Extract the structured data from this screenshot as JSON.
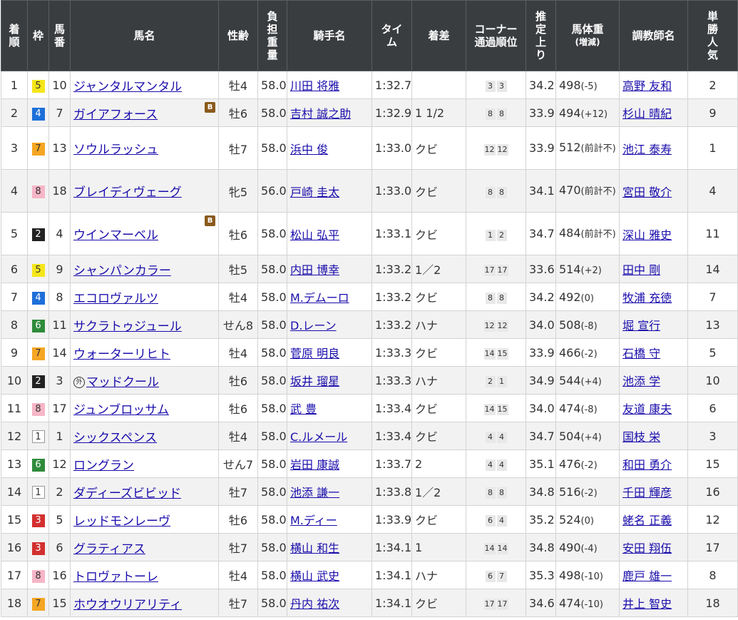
{
  "headers": {
    "rank": "着順",
    "frame": "枠",
    "num": "馬番",
    "horse": "馬名",
    "sexage": "性齢",
    "load": "負担重量",
    "jockey": "騎手名",
    "time": "タイム",
    "margin": "着差",
    "corner": "コーナー通過順位",
    "last3f": "推定上り",
    "weight": "馬体重",
    "weight_sub": "(増減)",
    "trainer": "調教師名",
    "pop": "単勝人気"
  },
  "rows": [
    {
      "rank": "1",
      "frame": "5",
      "num": "10",
      "horse": "ジャンタルマンタル",
      "blinker": "",
      "foreign": "",
      "sexage": "牡4",
      "load": "58.0",
      "jockey": "川田 将雅",
      "time": "1:32.7",
      "margin": "",
      "c1": "3",
      "c2": "3",
      "last3f": "34.2",
      "weight": "498",
      "diff": "(-5)",
      "trainer": "高野 友和",
      "pop": "2"
    },
    {
      "rank": "2",
      "frame": "4",
      "num": "7",
      "horse": "ガイアフォース",
      "blinker": "B",
      "foreign": "",
      "sexage": "牡6",
      "load": "58.0",
      "jockey": "吉村 誠之助",
      "time": "1:32.9",
      "margin": "1 1/2",
      "c1": "8",
      "c2": "8",
      "last3f": "33.9",
      "weight": "494",
      "diff": "(+12)",
      "trainer": "杉山 晴紀",
      "pop": "9"
    },
    {
      "rank": "3",
      "frame": "7",
      "num": "13",
      "horse": "ソウルラッシュ",
      "blinker": "",
      "foreign": "",
      "sexage": "牡7",
      "load": "58.0",
      "jockey": "浜中 俊",
      "time": "1:33.0",
      "margin": "クビ",
      "c1": "12",
      "c2": "12",
      "last3f": "33.9",
      "weight": "512",
      "diff": "(前計不)",
      "trainer": "池江 泰寿",
      "pop": "1"
    },
    {
      "rank": "4",
      "frame": "8",
      "num": "18",
      "horse": "ブレイディヴェーグ",
      "blinker": "",
      "foreign": "",
      "sexage": "牝5",
      "load": "56.0",
      "jockey": "戸崎 圭太",
      "time": "1:33.0",
      "margin": "クビ",
      "c1": "8",
      "c2": "8",
      "last3f": "34.1",
      "weight": "470",
      "diff": "(前計不)",
      "trainer": "宮田 敬介",
      "pop": "4"
    },
    {
      "rank": "5",
      "frame": "2",
      "num": "4",
      "horse": "ウインマーベル",
      "blinker": "B",
      "foreign": "",
      "sexage": "牡6",
      "load": "58.0",
      "jockey": "松山 弘平",
      "time": "1:33.1",
      "margin": "クビ",
      "c1": "1",
      "c2": "2",
      "last3f": "34.7",
      "weight": "484",
      "diff": "(前計不)",
      "trainer": "深山 雅史",
      "pop": "11"
    },
    {
      "rank": "6",
      "frame": "5",
      "num": "9",
      "horse": "シャンパンカラー",
      "blinker": "",
      "foreign": "",
      "sexage": "牡5",
      "load": "58.0",
      "jockey": "内田 博幸",
      "time": "1:33.2",
      "margin": "1／2",
      "c1": "17",
      "c2": "17",
      "last3f": "33.6",
      "weight": "514",
      "diff": "(+2)",
      "trainer": "田中 剛",
      "pop": "14"
    },
    {
      "rank": "7",
      "frame": "4",
      "num": "8",
      "horse": "エコロヴァルツ",
      "blinker": "",
      "foreign": "",
      "sexage": "牡4",
      "load": "58.0",
      "jockey": "M.デムーロ",
      "time": "1:33.2",
      "margin": "クビ",
      "c1": "8",
      "c2": "8",
      "last3f": "34.2",
      "weight": "492",
      "diff": "(0)",
      "trainer": "牧浦 充徳",
      "pop": "7"
    },
    {
      "rank": "8",
      "frame": "6",
      "num": "11",
      "horse": "サクラトゥジュール",
      "blinker": "",
      "foreign": "",
      "sexage": "せん8",
      "load": "58.0",
      "jockey": "D.レーン",
      "time": "1:33.2",
      "margin": "ハナ",
      "c1": "12",
      "c2": "12",
      "last3f": "34.0",
      "weight": "508",
      "diff": "(-8)",
      "trainer": "堀 宣行",
      "pop": "13"
    },
    {
      "rank": "9",
      "frame": "7",
      "num": "14",
      "horse": "ウォーターリヒト",
      "blinker": "",
      "foreign": "",
      "sexage": "牡4",
      "load": "58.0",
      "jockey": "菅原 明良",
      "time": "1:33.3",
      "margin": "クビ",
      "c1": "14",
      "c2": "15",
      "last3f": "33.9",
      "weight": "466",
      "diff": "(-2)",
      "trainer": "石橋 守",
      "pop": "5"
    },
    {
      "rank": "10",
      "frame": "2",
      "num": "3",
      "horse": "マッドクール",
      "blinker": "",
      "foreign": "外",
      "sexage": "牡6",
      "load": "58.0",
      "jockey": "坂井 瑠星",
      "time": "1:33.3",
      "margin": "ハナ",
      "c1": "2",
      "c2": "1",
      "last3f": "34.9",
      "weight": "544",
      "diff": "(+4)",
      "trainer": "池添 学",
      "pop": "10"
    },
    {
      "rank": "11",
      "frame": "8",
      "num": "17",
      "horse": "ジュンブロッサム",
      "blinker": "",
      "foreign": "",
      "sexage": "牡6",
      "load": "58.0",
      "jockey": "武 豊",
      "time": "1:33.4",
      "margin": "クビ",
      "c1": "14",
      "c2": "15",
      "last3f": "34.0",
      "weight": "474",
      "diff": "(-8)",
      "trainer": "友道 康夫",
      "pop": "6"
    },
    {
      "rank": "12",
      "frame": "1",
      "num": "1",
      "horse": "シックスペンス",
      "blinker": "",
      "foreign": "",
      "sexage": "牡4",
      "load": "58.0",
      "jockey": "C.ルメール",
      "time": "1:33.4",
      "margin": "クビ",
      "c1": "4",
      "c2": "4",
      "last3f": "34.7",
      "weight": "504",
      "diff": "(+4)",
      "trainer": "国枝 栄",
      "pop": "3"
    },
    {
      "rank": "13",
      "frame": "6",
      "num": "12",
      "horse": "ロングラン",
      "blinker": "",
      "foreign": "",
      "sexage": "せん7",
      "load": "58.0",
      "jockey": "岩田 康誠",
      "time": "1:33.7",
      "margin": "2",
      "c1": "4",
      "c2": "4",
      "last3f": "35.1",
      "weight": "476",
      "diff": "(-2)",
      "trainer": "和田 勇介",
      "pop": "15"
    },
    {
      "rank": "14",
      "frame": "1",
      "num": "2",
      "horse": "ダディーズビビッド",
      "blinker": "",
      "foreign": "",
      "sexage": "牡7",
      "load": "58.0",
      "jockey": "池添 謙一",
      "time": "1:33.8",
      "margin": "1／2",
      "c1": "8",
      "c2": "8",
      "last3f": "34.8",
      "weight": "516",
      "diff": "(-2)",
      "trainer": "千田 輝彦",
      "pop": "16"
    },
    {
      "rank": "15",
      "frame": "3",
      "num": "5",
      "horse": "レッドモンレーヴ",
      "blinker": "",
      "foreign": "",
      "sexage": "牡6",
      "load": "58.0",
      "jockey": "M.ディー",
      "time": "1:33.9",
      "margin": "クビ",
      "c1": "6",
      "c2": "4",
      "last3f": "35.2",
      "weight": "524",
      "diff": "(0)",
      "trainer": "蛯名 正義",
      "pop": "12"
    },
    {
      "rank": "16",
      "frame": "3",
      "num": "6",
      "horse": "グラティアス",
      "blinker": "",
      "foreign": "",
      "sexage": "牡7",
      "load": "58.0",
      "jockey": "横山 和生",
      "time": "1:34.1",
      "margin": "1",
      "c1": "14",
      "c2": "14",
      "last3f": "34.8",
      "weight": "490",
      "diff": "(-4)",
      "trainer": "安田 翔伍",
      "pop": "17"
    },
    {
      "rank": "17",
      "frame": "8",
      "num": "16",
      "horse": "トロヴァトーレ",
      "blinker": "",
      "foreign": "",
      "sexage": "牡4",
      "load": "58.0",
      "jockey": "横山 武史",
      "time": "1:34.1",
      "margin": "ハナ",
      "c1": "6",
      "c2": "7",
      "last3f": "35.3",
      "weight": "498",
      "diff": "(-10)",
      "trainer": "鹿戸 雄一",
      "pop": "8"
    },
    {
      "rank": "18",
      "frame": "7",
      "num": "15",
      "horse": "ホウオウリアリティ",
      "blinker": "",
      "foreign": "",
      "sexage": "牡7",
      "load": "58.0",
      "jockey": "丹内 祐次",
      "time": "1:34.1",
      "margin": "クビ",
      "c1": "17",
      "c2": "17",
      "last3f": "34.6",
      "weight": "474",
      "diff": "(-10)",
      "trainer": "井上 智史",
      "pop": "18"
    }
  ]
}
